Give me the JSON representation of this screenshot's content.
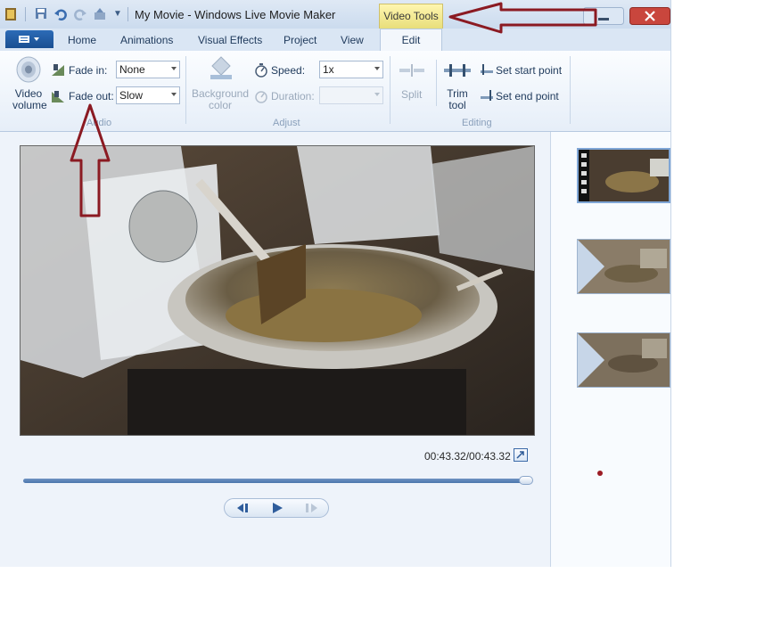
{
  "window": {
    "title": "My Movie - Windows Live Movie Maker",
    "contextual_tab_group": "Video Tools"
  },
  "tabs": [
    {
      "label": "Home"
    },
    {
      "label": "Animations"
    },
    {
      "label": "Visual Effects"
    },
    {
      "label": "Project"
    },
    {
      "label": "View"
    },
    {
      "label": "Edit",
      "active": true
    }
  ],
  "ribbon": {
    "audio": {
      "video_volume_label": "Video volume",
      "fade_in_label": "Fade in:",
      "fade_in_value": "None",
      "fade_out_label": "Fade out:",
      "fade_out_value": "Slow",
      "group_label": "Audio"
    },
    "adjust": {
      "background_color_label": "Background color",
      "speed_label": "Speed:",
      "speed_value": "1x",
      "duration_label": "Duration:",
      "duration_value": "",
      "group_label": "Adjust"
    },
    "editing": {
      "split_label": "Split",
      "trim_tool_label": "Trim tool",
      "set_start_point_label": "Set start point",
      "set_end_point_label": "Set end point",
      "group_label": "Editing"
    }
  },
  "preview": {
    "time_display": "00:43.32/00:43.32",
    "seek_position": 1.0
  },
  "colors": {
    "annotation_arrow": "#8b1a22",
    "contextual_tab": "#f2e98c",
    "ribbon_accent": "#1e395b"
  }
}
